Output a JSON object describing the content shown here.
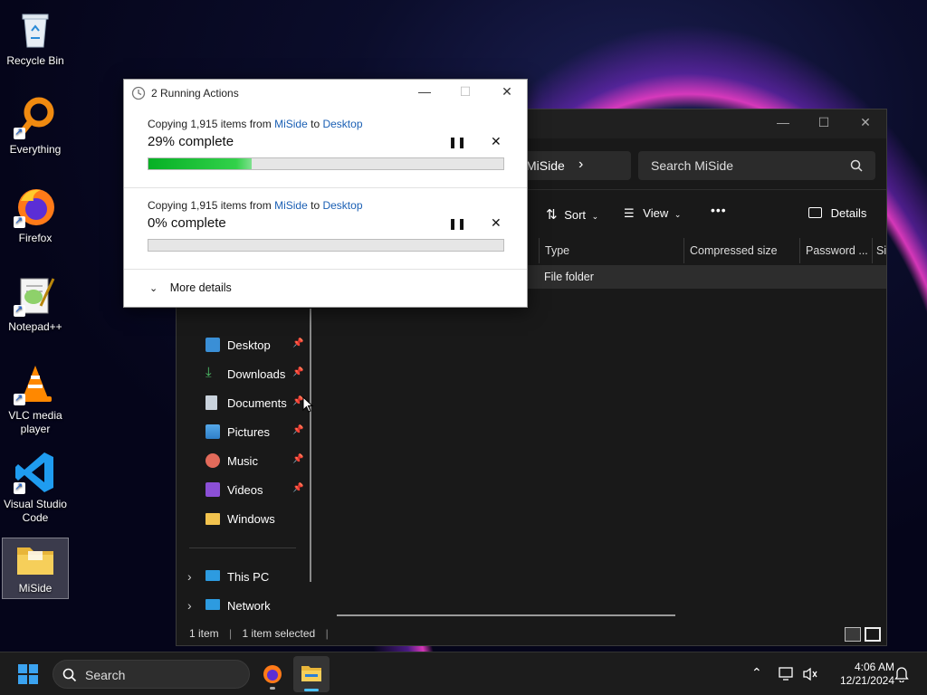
{
  "desktop": {
    "icons": [
      {
        "label": "Recycle Bin"
      },
      {
        "label": "Everything"
      },
      {
        "label": "Firefox"
      },
      {
        "label": "Notepad++"
      },
      {
        "label": "VLC media player"
      },
      {
        "label": "Visual Studio Code"
      },
      {
        "label": "MiSide"
      }
    ]
  },
  "explorer": {
    "breadcrumb_current": "MiSide",
    "search_placeholder": "Search MiSide",
    "toolbar": {
      "sort": "Sort",
      "view": "View",
      "more": "•••",
      "details": "Details"
    },
    "columns": [
      "Type",
      "Compressed size",
      "Password ...",
      "Si"
    ],
    "rows": [
      {
        "type": "File folder"
      }
    ],
    "nav": [
      {
        "label": "Desktop",
        "icon": "desktop-icon",
        "pinned": true
      },
      {
        "label": "Downloads",
        "icon": "download-icon",
        "pinned": true
      },
      {
        "label": "Documents",
        "icon": "documents-icon",
        "pinned": true
      },
      {
        "label": "Pictures",
        "icon": "pictures-icon",
        "pinned": true
      },
      {
        "label": "Music",
        "icon": "music-icon",
        "pinned": true
      },
      {
        "label": "Videos",
        "icon": "videos-icon",
        "pinned": true
      },
      {
        "label": "Windows",
        "icon": "folder-icon",
        "pinned": false
      },
      {
        "label": "This PC",
        "icon": "pc-icon"
      },
      {
        "label": "Network",
        "icon": "network-icon"
      }
    ],
    "status": {
      "items": "1 item",
      "selected": "1 item selected"
    }
  },
  "dialog": {
    "title": "2 Running Actions",
    "operations": [
      {
        "prefix": "Copying 1,915 items from",
        "source": "MiSide",
        "middle": "to",
        "dest": "Desktop",
        "percent_text": "29% complete",
        "progress": 0.29
      },
      {
        "prefix": "Copying 1,915 items from",
        "source": "MiSide",
        "middle": "to",
        "dest": "Desktop",
        "percent_text": "0% complete",
        "progress": 0
      }
    ],
    "more_details": "More details"
  },
  "taskbar": {
    "search_label": "Search",
    "time": "4:06 AM",
    "date": "12/21/2024"
  },
  "colors": {
    "accent": "#0078d4",
    "progress_green": "#06b025"
  }
}
